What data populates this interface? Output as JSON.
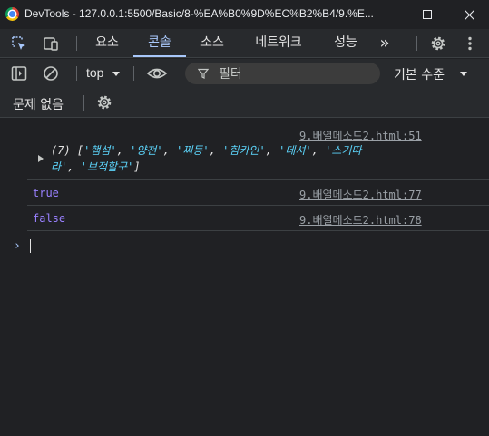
{
  "window": {
    "title": "DevTools - 127.0.0.1:5500/Basic/8-%EA%B0%9D%EC%B2%B4/9.%E...",
    "minimize_icon": "minimize-icon",
    "maximize_icon": "maximize-icon",
    "close_icon": "close-icon"
  },
  "tabs": [
    {
      "label": "요소"
    },
    {
      "label": "콘솔"
    },
    {
      "label": "소스"
    },
    {
      "label": "네트워크"
    },
    {
      "label": "성능"
    }
  ],
  "active_tab": "콘솔",
  "more_tabs": "»",
  "console_toolbar": {
    "context": "top",
    "filter_placeholder": "필터",
    "levels": "기본 수준"
  },
  "issues": {
    "text": "문제 없음"
  },
  "messages": [
    {
      "source": "9.배열메소드2.html:51",
      "count": "(7) ",
      "items": [
        "'햄섬'",
        "'양천'",
        "'찌등'",
        "'힘카인'",
        "'데셔'",
        "'스기따",
        "라'",
        "'브적할구'"
      ]
    },
    {
      "value": "true",
      "source": "9.배열메소드2.html:77"
    },
    {
      "value": "false",
      "source": "9.배열메소드2.html:78"
    }
  ],
  "prompt": "›",
  "colors": {
    "accent": "#a8c7fa",
    "string": "#5cd5fb",
    "boolean": "#9980ff",
    "background": "#202124",
    "toolbar": "#282a2d"
  }
}
